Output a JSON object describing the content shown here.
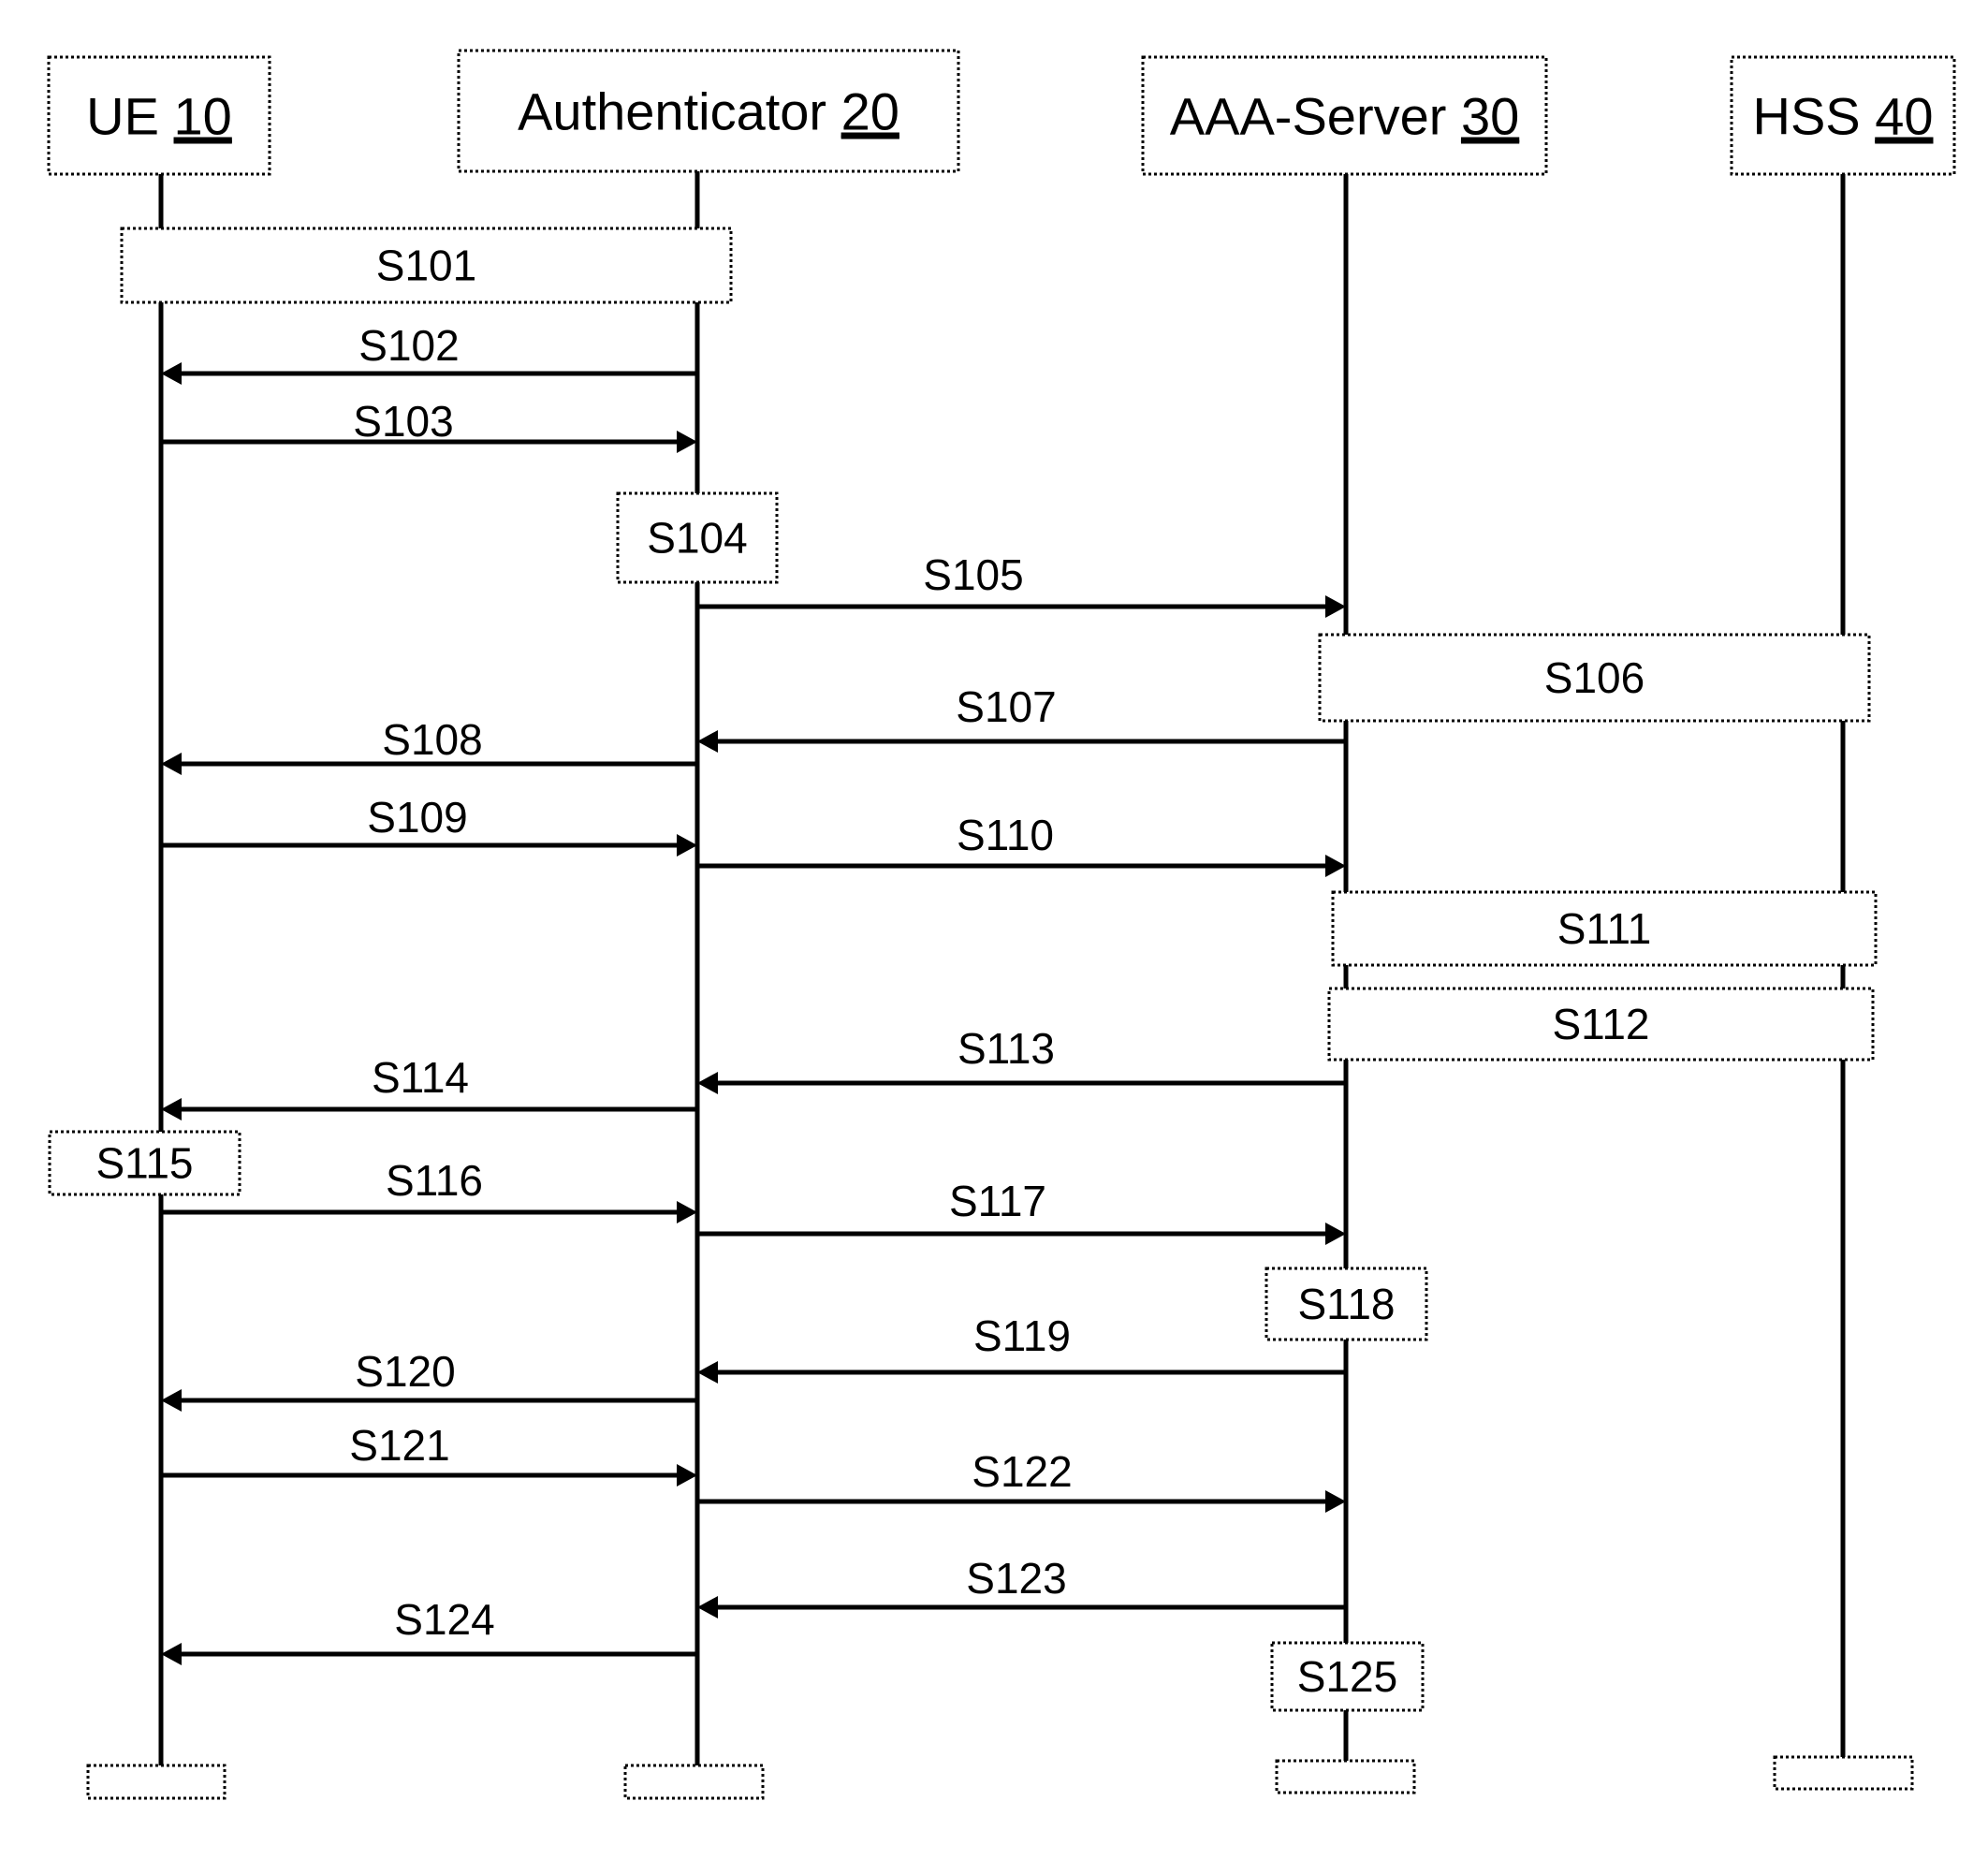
{
  "diagram": {
    "type": "sequence-diagram",
    "participants": [
      {
        "id": "ue",
        "name": "UE",
        "ref": "10"
      },
      {
        "id": "auth",
        "name": "Authenticator",
        "ref": "20"
      },
      {
        "id": "aaa",
        "name": "AAA-Server",
        "ref": "30"
      },
      {
        "id": "hss",
        "name": "HSS",
        "ref": "40"
      }
    ],
    "steps": [
      {
        "label": "S101",
        "kind": "process",
        "span": [
          "ue",
          "auth"
        ]
      },
      {
        "label": "S102",
        "kind": "message",
        "from": "auth",
        "to": "ue"
      },
      {
        "label": "S103",
        "kind": "message",
        "from": "ue",
        "to": "auth"
      },
      {
        "label": "S104",
        "kind": "process",
        "span": [
          "auth"
        ]
      },
      {
        "label": "S105",
        "kind": "message",
        "from": "auth",
        "to": "aaa"
      },
      {
        "label": "S106",
        "kind": "process",
        "span": [
          "aaa",
          "hss"
        ]
      },
      {
        "label": "S107",
        "kind": "message",
        "from": "aaa",
        "to": "auth"
      },
      {
        "label": "S108",
        "kind": "message",
        "from": "auth",
        "to": "ue"
      },
      {
        "label": "S109",
        "kind": "message",
        "from": "ue",
        "to": "auth"
      },
      {
        "label": "S110",
        "kind": "message",
        "from": "auth",
        "to": "aaa"
      },
      {
        "label": "S111",
        "kind": "process",
        "span": [
          "aaa",
          "hss"
        ]
      },
      {
        "label": "S112",
        "kind": "process",
        "span": [
          "aaa",
          "hss"
        ]
      },
      {
        "label": "S113",
        "kind": "message",
        "from": "aaa",
        "to": "auth"
      },
      {
        "label": "S114",
        "kind": "message",
        "from": "auth",
        "to": "ue"
      },
      {
        "label": "S115",
        "kind": "process",
        "span": [
          "ue"
        ]
      },
      {
        "label": "S116",
        "kind": "message",
        "from": "ue",
        "to": "auth"
      },
      {
        "label": "S117",
        "kind": "message",
        "from": "auth",
        "to": "aaa"
      },
      {
        "label": "S118",
        "kind": "process",
        "span": [
          "aaa"
        ]
      },
      {
        "label": "S119",
        "kind": "message",
        "from": "aaa",
        "to": "auth"
      },
      {
        "label": "S120",
        "kind": "message",
        "from": "auth",
        "to": "ue"
      },
      {
        "label": "S121",
        "kind": "message",
        "from": "ue",
        "to": "auth"
      },
      {
        "label": "S122",
        "kind": "message",
        "from": "auth",
        "to": "aaa"
      },
      {
        "label": "S123",
        "kind": "message",
        "from": "aaa",
        "to": "auth"
      },
      {
        "label": "S124",
        "kind": "message",
        "from": "auth",
        "to": "ue"
      },
      {
        "label": "S125",
        "kind": "process",
        "span": [
          "aaa"
        ]
      }
    ]
  }
}
